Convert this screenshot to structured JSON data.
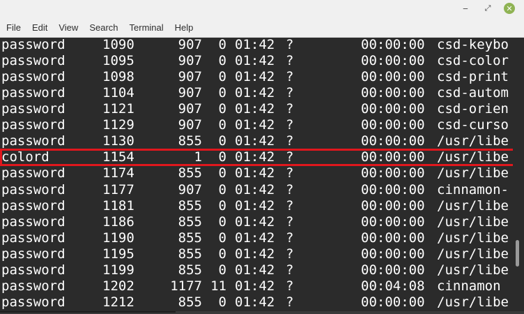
{
  "window": {
    "minimize_glyph": "‒",
    "maximize_glyph": "⤢",
    "close_glyph": "✕"
  },
  "menu": [
    "File",
    "Edit",
    "View",
    "Search",
    "Terminal",
    "Help"
  ],
  "process_rows": [
    {
      "user": "password",
      "pid": "1090",
      "ppid": "907",
      "c": "0",
      "stime": "01:42",
      "tty": "?",
      "time": "00:00:00",
      "cmd": "csd-keybo"
    },
    {
      "user": "password",
      "pid": "1095",
      "ppid": "907",
      "c": "0",
      "stime": "01:42",
      "tty": "?",
      "time": "00:00:00",
      "cmd": "csd-color"
    },
    {
      "user": "password",
      "pid": "1098",
      "ppid": "907",
      "c": "0",
      "stime": "01:42",
      "tty": "?",
      "time": "00:00:00",
      "cmd": "csd-print"
    },
    {
      "user": "password",
      "pid": "1104",
      "ppid": "907",
      "c": "0",
      "stime": "01:42",
      "tty": "?",
      "time": "00:00:00",
      "cmd": "csd-autom"
    },
    {
      "user": "password",
      "pid": "1121",
      "ppid": "907",
      "c": "0",
      "stime": "01:42",
      "tty": "?",
      "time": "00:00:00",
      "cmd": "csd-orien"
    },
    {
      "user": "password",
      "pid": "1129",
      "ppid": "907",
      "c": "0",
      "stime": "01:42",
      "tty": "?",
      "time": "00:00:00",
      "cmd": "csd-curso"
    },
    {
      "user": "password",
      "pid": "1130",
      "ppid": "855",
      "c": "0",
      "stime": "01:42",
      "tty": "?",
      "time": "00:00:00",
      "cmd": "/usr/libe"
    },
    {
      "user": "colord",
      "pid": "1154",
      "ppid": "1",
      "c": "0",
      "stime": "01:42",
      "tty": "?",
      "time": "00:00:00",
      "cmd": "/usr/libe"
    },
    {
      "user": "password",
      "pid": "1174",
      "ppid": "855",
      "c": "0",
      "stime": "01:42",
      "tty": "?",
      "time": "00:00:00",
      "cmd": "/usr/libe"
    },
    {
      "user": "password",
      "pid": "1177",
      "ppid": "907",
      "c": "0",
      "stime": "01:42",
      "tty": "?",
      "time": "00:00:00",
      "cmd": "cinnamon-"
    },
    {
      "user": "password",
      "pid": "1181",
      "ppid": "855",
      "c": "0",
      "stime": "01:42",
      "tty": "?",
      "time": "00:00:00",
      "cmd": "/usr/libe"
    },
    {
      "user": "password",
      "pid": "1186",
      "ppid": "855",
      "c": "0",
      "stime": "01:42",
      "tty": "?",
      "time": "00:00:00",
      "cmd": "/usr/libe"
    },
    {
      "user": "password",
      "pid": "1190",
      "ppid": "855",
      "c": "0",
      "stime": "01:42",
      "tty": "?",
      "time": "00:00:00",
      "cmd": "/usr/libe"
    },
    {
      "user": "password",
      "pid": "1195",
      "ppid": "855",
      "c": "0",
      "stime": "01:42",
      "tty": "?",
      "time": "00:00:00",
      "cmd": "/usr/libe"
    },
    {
      "user": "password",
      "pid": "1199",
      "ppid": "855",
      "c": "0",
      "stime": "01:42",
      "tty": "?",
      "time": "00:00:00",
      "cmd": "/usr/libe"
    },
    {
      "user": "password",
      "pid": "1202",
      "ppid": "1177",
      "c": "11",
      "stime": "01:42",
      "tty": "?",
      "time": "00:04:08",
      "cmd": "cinnamon"
    },
    {
      "user": "password",
      "pid": "1212",
      "ppid": "855",
      "c": "0",
      "stime": "01:42",
      "tty": "?",
      "time": "00:00:00",
      "cmd": "/usr/libe"
    }
  ],
  "colors": {
    "terminal_bg": "#2b2b2b",
    "terminal_fg": "#ffffff",
    "highlight_border": "#e0171d",
    "close_button": "#8fb354"
  }
}
